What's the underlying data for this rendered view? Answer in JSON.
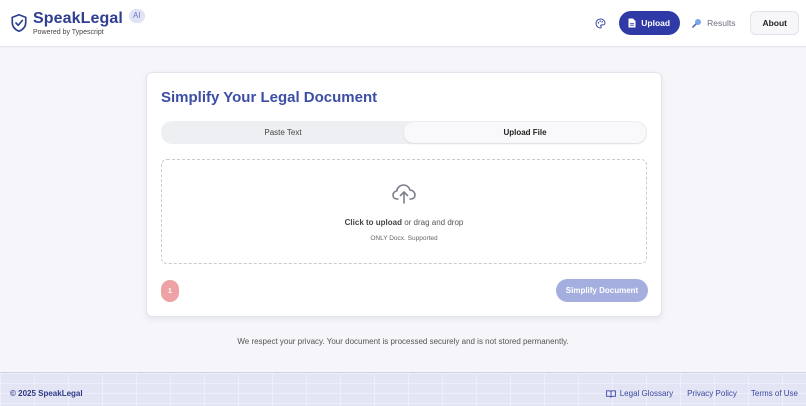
{
  "brand": {
    "name": "SpeakLegal",
    "badge": "AI",
    "tagline": "Powered by Typescript"
  },
  "nav": {
    "palette_icon": "palette-icon",
    "upload_label": "Upload",
    "results_label": "Results",
    "about_label": "About"
  },
  "card": {
    "title": "Simplify Your Legal Document",
    "tabs": [
      {
        "label": "Paste Text",
        "active": false
      },
      {
        "label": "Upload File",
        "active": true
      }
    ],
    "dropzone": {
      "icon": "cloud-upload-icon",
      "click_text": "Click to upload",
      "drag_text": " or drag and drop",
      "supported_text": "ONLY Docx. Supported"
    },
    "alert_badge": "1",
    "submit_label": "Simplify Document"
  },
  "privacy_note": "We respect your privacy. Your document is processed securely and is not stored permanently.",
  "footer": {
    "copyright": "© 2025 SpeakLegal",
    "links": [
      "Legal Glossary",
      "Privacy Policy",
      "Terms of Use"
    ]
  },
  "colors": {
    "brand_primary": "#2f3aa7",
    "title_blue": "#3c4ea5",
    "submit_disabled": "#a4aedf",
    "alert_pink": "#eea2a5"
  }
}
